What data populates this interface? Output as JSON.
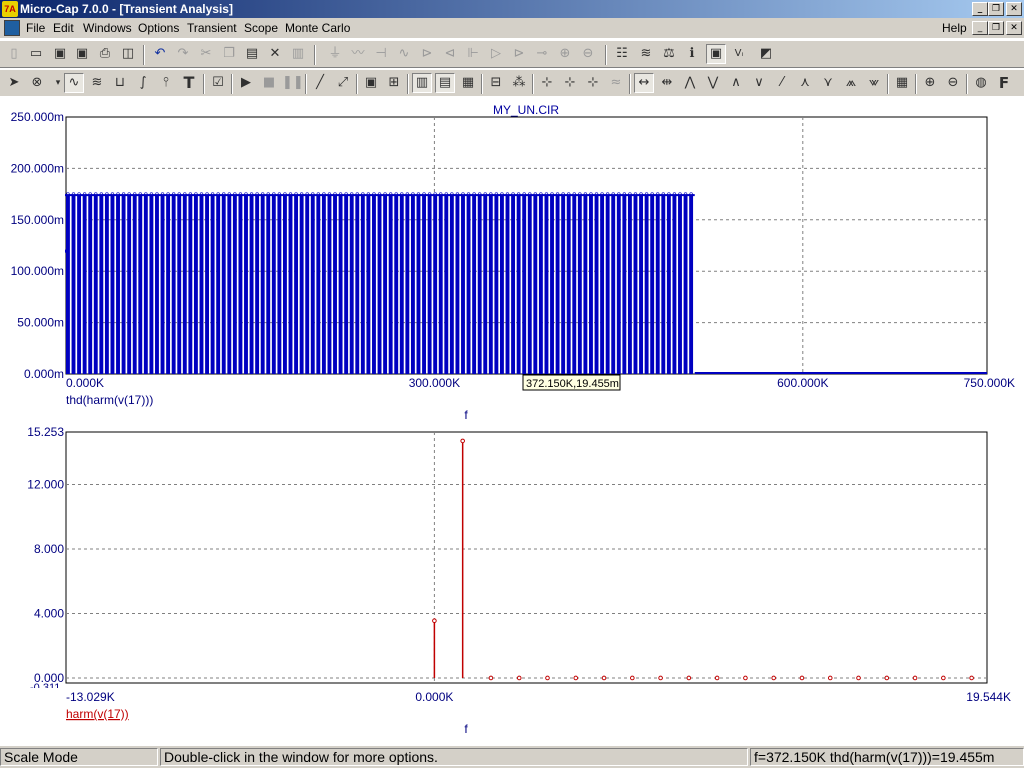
{
  "window": {
    "title": "Micro-Cap 7.0.0 - [Transient Analysis]",
    "app_icon": "7A"
  },
  "menu": {
    "items": [
      "File",
      "Edit",
      "Windows",
      "Options",
      "Transient",
      "Scope",
      "Monte Carlo"
    ],
    "help": "Help"
  },
  "toolbar1": {
    "icons": [
      "new-file-icon",
      "open-folder-icon",
      "save-icon",
      "save-all-icon",
      "print-icon",
      "print-preview-icon",
      "undo-icon",
      "redo-icon",
      "cut-icon",
      "copy-icon",
      "paste-icon",
      "delete-icon",
      "clear-icon",
      "ground-icon",
      "resistor-icon",
      "capacitor-icon",
      "inductor-icon",
      "diode-icon",
      "zener-icon",
      "transistor-icon",
      "opamp-icon",
      "buffer-icon",
      "switch-icon",
      "source-icon",
      "current-source-icon",
      "component-list-icon",
      "waveform-icon",
      "parameter-icon",
      "info-icon",
      "probe-icon",
      "vxy-icon",
      "help-icon"
    ]
  },
  "toolbar2": {
    "icons": [
      "select-arrow-icon",
      "component-mode-icon",
      "scale-mode-icon",
      "cursor-mode-icon",
      "point-tag-icon",
      "horizontal-tag-icon",
      "vertical-tag-icon",
      "text-icon",
      "properties-icon",
      "run-icon",
      "stop-icon",
      "pause-icon",
      "line-icon",
      "diagonal-icon",
      "box-icon",
      "grid-icon",
      "fill-icon",
      "minor-grid-icon",
      "x-axis-icon",
      "scatter-icon",
      "peak-icon",
      "valley-icon",
      "high-icon",
      "low-icon",
      "inflection-icon",
      "global-high-icon",
      "global-low-icon",
      "slope-icon",
      "zoom-in-icon",
      "zoom-out-icon",
      "globe-icon",
      "font-icon"
    ]
  },
  "plot1": {
    "title": "MY_UN.CIR",
    "ylabels": [
      "250.000m",
      "200.000m",
      "150.000m",
      "100.000m",
      "50.000m",
      "0.000m"
    ],
    "xlabels": [
      "0.000K",
      "300.000K",
      "600.000K",
      "750.000K"
    ],
    "ylabel": "thd(harm(v(17)))",
    "xlabel": "f",
    "tooltip": "372.150K,19.455m",
    "color": "#0000c0"
  },
  "plot2": {
    "ylabels": [
      "15.253",
      "12.000",
      "8.000",
      "4.000",
      "0.000"
    ],
    "ymin_label_partial": "-0.311",
    "xlabels": [
      "-13.029K",
      "0.000K",
      "19.544K"
    ],
    "ylabel": "harm(v(17))",
    "xlabel": "f",
    "color": "#c00000"
  },
  "chart_data": [
    {
      "type": "bar",
      "title": "MY_UN.CIR",
      "xlabel": "f",
      "ylabel": "thd(harm(v(17)))",
      "xlim": [
        0,
        750000
      ],
      "ylim": [
        0,
        0.25
      ],
      "series": [
        {
          "name": "thd(harm(v(17)))",
          "x_start": 0,
          "x_end": 512000,
          "bar_count": 113,
          "value": 0.175,
          "after_value": 0,
          "first_point": 0.12
        }
      ],
      "cursor": {
        "x": 372150,
        "y": 0.019455
      }
    },
    {
      "type": "bar",
      "xlabel": "f",
      "ylabel": "harm(v(17))",
      "xlim": [
        -13029,
        19544
      ],
      "ylim": [
        -0.311,
        15.253
      ],
      "series": [
        {
          "name": "harm(v(17))",
          "x": [
            0,
            1000,
            2000,
            3000,
            4000,
            5000,
            6000,
            7000,
            8000,
            9000,
            10000,
            11000,
            12000,
            13000,
            14000,
            15000,
            16000,
            17000,
            18000,
            19000
          ],
          "values": [
            3.55,
            14.7,
            0,
            0,
            0,
            0,
            0,
            0,
            0,
            0,
            0,
            0,
            0,
            0,
            0,
            0,
            0,
            0,
            0,
            0
          ]
        }
      ]
    }
  ],
  "status": {
    "mode": "Scale Mode",
    "hint": "Double-click in the window for more options.",
    "readout": "f=372.150K thd(harm(v(17)))=19.455m"
  }
}
